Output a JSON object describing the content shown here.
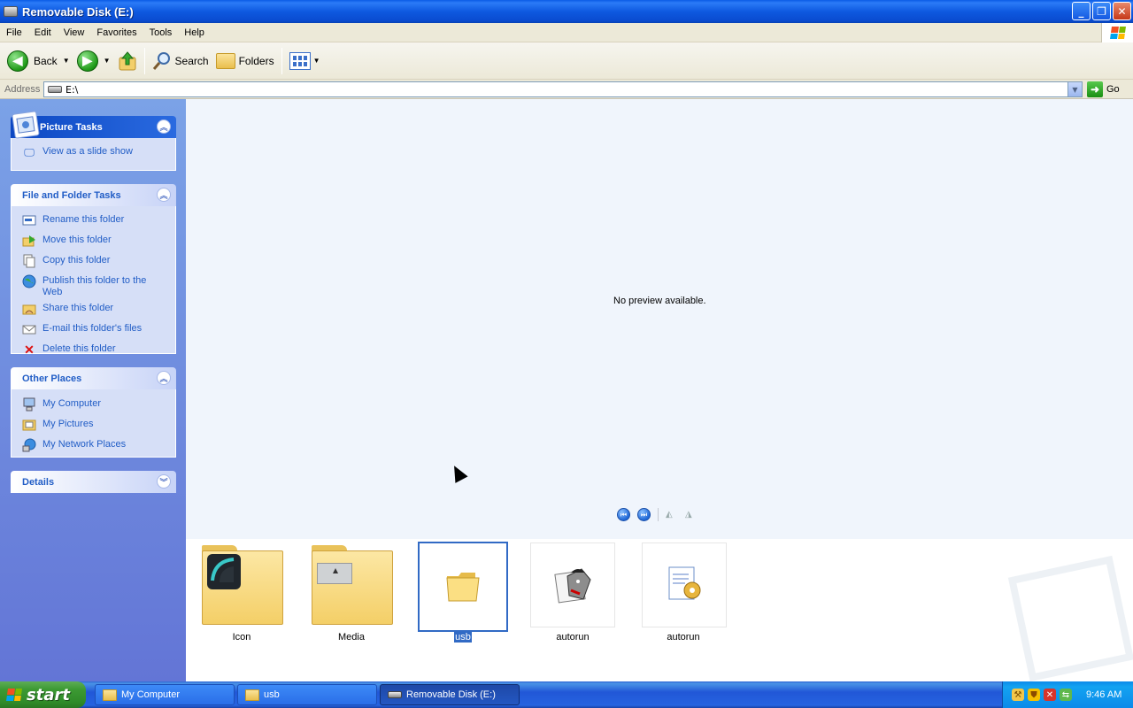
{
  "window": {
    "title": "Removable Disk (E:)",
    "buttons": {
      "minimize": "_",
      "maximize": "❐",
      "close": "✕"
    }
  },
  "menu": {
    "items": [
      "File",
      "Edit",
      "View",
      "Favorites",
      "Tools",
      "Help"
    ]
  },
  "toolbar": {
    "back_label": "Back",
    "search_label": "Search",
    "folders_label": "Folders"
  },
  "address": {
    "label": "Address",
    "value": "E:\\",
    "go_label": "Go"
  },
  "left_pane": {
    "picture_tasks": {
      "title": "Picture Tasks",
      "items": [
        {
          "label": "View as a slide show",
          "icon": "slideshow-icon"
        }
      ]
    },
    "file_folder_tasks": {
      "title": "File and Folder Tasks",
      "items": [
        {
          "label": "Rename this folder",
          "icon": "rename-icon"
        },
        {
          "label": "Move this folder",
          "icon": "move-icon"
        },
        {
          "label": "Copy this folder",
          "icon": "copy-icon"
        },
        {
          "label": "Publish this folder to the Web",
          "icon": "globe-icon"
        },
        {
          "label": "Share this folder",
          "icon": "share-icon"
        },
        {
          "label": "E-mail this folder's files",
          "icon": "email-icon"
        },
        {
          "label": "Delete this folder",
          "icon": "delete-icon"
        }
      ]
    },
    "other_places": {
      "title": "Other Places",
      "items": [
        {
          "label": "My Computer",
          "icon": "computer-icon"
        },
        {
          "label": "My Pictures",
          "icon": "pictures-icon"
        },
        {
          "label": "My Network Places",
          "icon": "network-icon"
        }
      ]
    },
    "details": {
      "title": "Details"
    }
  },
  "preview": {
    "message": "No preview available."
  },
  "files": [
    {
      "name": "Icon",
      "kind": "folder"
    },
    {
      "name": "Media",
      "kind": "folder"
    },
    {
      "name": "usb",
      "kind": "folder",
      "selected": true
    },
    {
      "name": "autorun",
      "kind": "icon-file"
    },
    {
      "name": "autorun",
      "kind": "inf-file"
    }
  ],
  "taskbar": {
    "start_label": "start",
    "buttons": [
      {
        "label": "My Computer",
        "icon": "folder-icon"
      },
      {
        "label": "usb",
        "icon": "folder-icon"
      },
      {
        "label": "Removable Disk (E:)",
        "icon": "drive-icon",
        "active": true
      }
    ],
    "clock": "9:46 AM"
  },
  "colors": {
    "accent": "#316ac5",
    "titlebar": "#0a4bd0",
    "task_link": "#215dc6",
    "taskbar": "#2157d7",
    "start": "#3c9a33"
  }
}
